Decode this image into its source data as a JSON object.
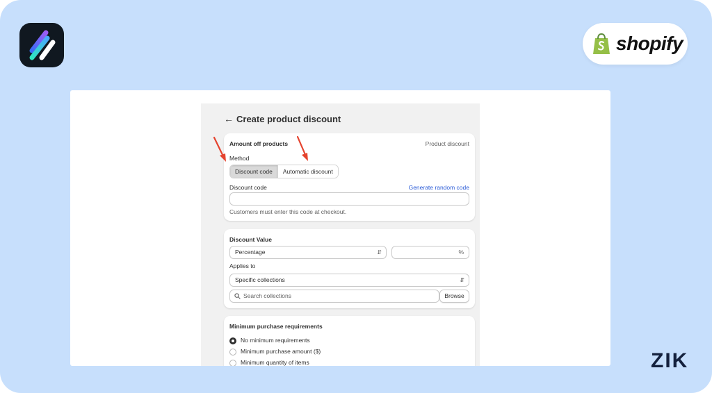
{
  "brand": {
    "shopify_wordmark": "shopify",
    "corner_mark": "ZIK",
    "accent_color": "#c7dffc"
  },
  "page": {
    "title": "Create product discount",
    "back_icon": "arrow-left-icon"
  },
  "discount_panel": {
    "heading": "Amount off products",
    "type_label": "Product discount",
    "method_label": "Method",
    "methods": [
      {
        "label": "Discount code",
        "selected": true
      },
      {
        "label": "Automatic discount",
        "selected": false
      }
    ],
    "code_label": "Discount code",
    "generate_link": "Generate random code",
    "code_value": "",
    "help_text": "Customers must enter this code at checkout."
  },
  "value_panel": {
    "heading": "Discount Value",
    "value_type": "Percentage",
    "amount_value": "",
    "amount_suffix": "%",
    "applies_to_label": "Applies to",
    "applies_to_value": "Specific collections",
    "search_placeholder": "Search collections",
    "browse_label": "Browse"
  },
  "requirements_panel": {
    "heading": "Minimum purchase requirements",
    "options": [
      {
        "label": "No minimum requirements",
        "checked": true
      },
      {
        "label": "Minimum purchase amount ($)",
        "checked": false
      },
      {
        "label": "Minimum quantity of items",
        "checked": false
      }
    ]
  }
}
